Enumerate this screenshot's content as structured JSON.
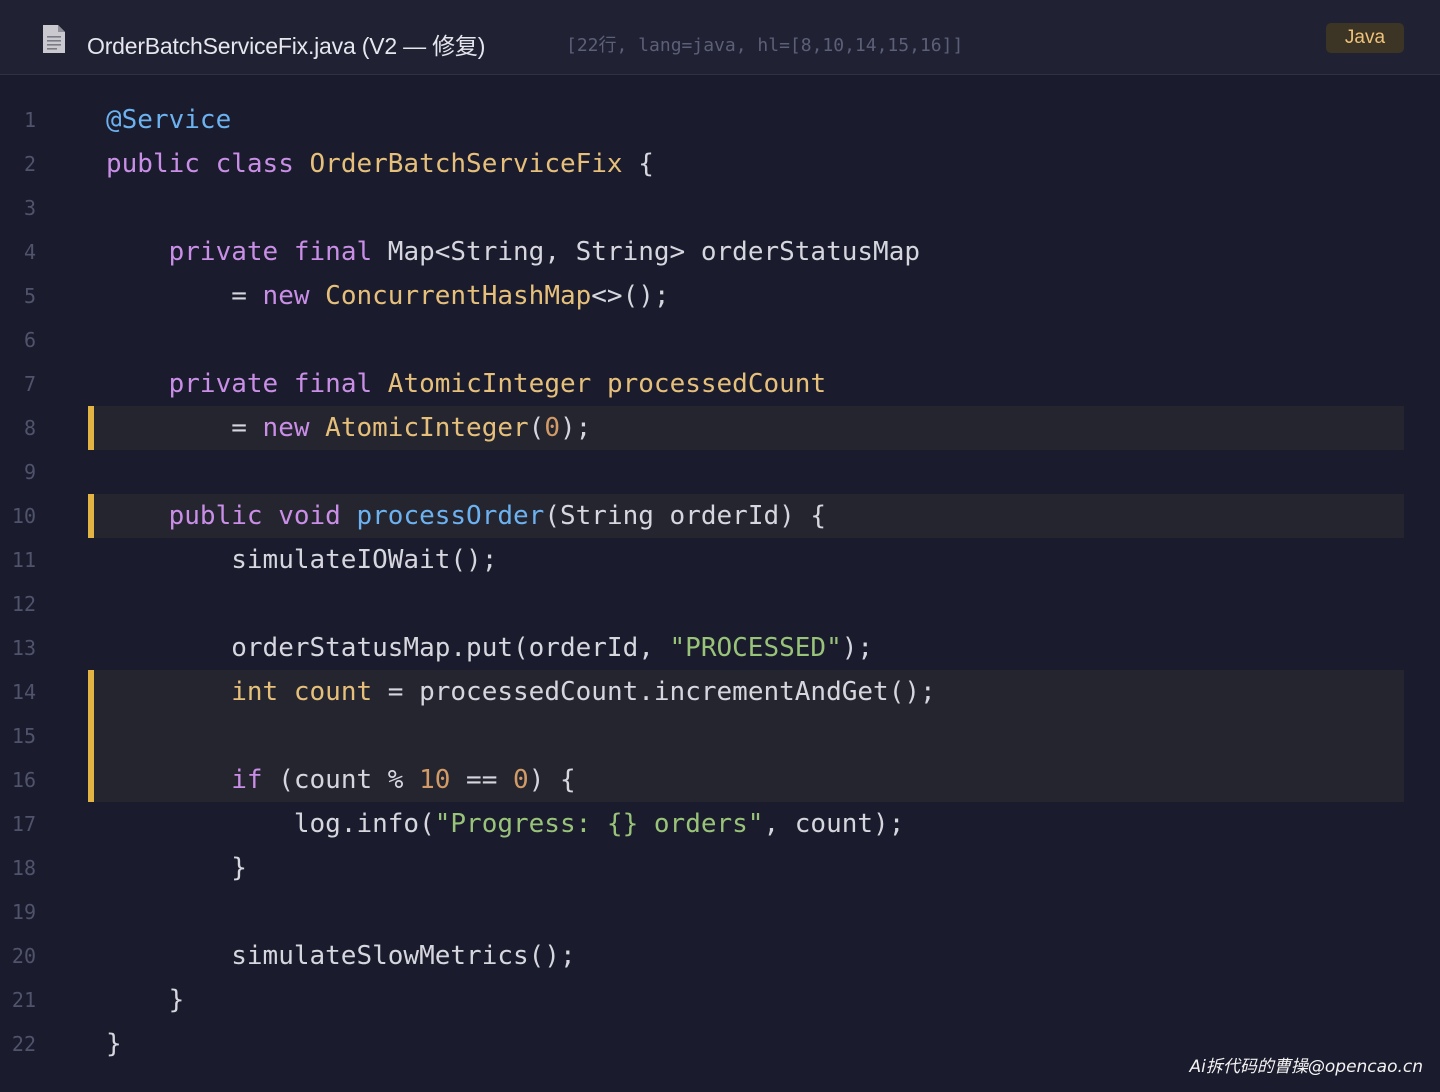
{
  "header": {
    "file_title": "OrderBatchServiceFix.java (V2 — 修复)",
    "meta": "[22行, lang=java, hl=[8,10,14,15,16]]",
    "language_badge": "Java",
    "icon": "file-document-icon"
  },
  "code": {
    "highlighted_lines": [
      8,
      10,
      14,
      15,
      16
    ],
    "lines": [
      {
        "n": "1",
        "indent": "",
        "tokens": [
          [
            "an",
            "@Service"
          ]
        ]
      },
      {
        "n": "2",
        "indent": "",
        "tokens": [
          [
            "kw",
            "public"
          ],
          [
            "",
            " "
          ],
          [
            "kw",
            "class"
          ],
          [
            "",
            " "
          ],
          [
            "ty",
            "OrderBatchServiceFix"
          ],
          [
            "",
            " {"
          ]
        ]
      },
      {
        "n": "3",
        "indent": "",
        "tokens": []
      },
      {
        "n": "4",
        "indent": "    ",
        "tokens": [
          [
            "kw",
            "private"
          ],
          [
            "",
            " "
          ],
          [
            "kw",
            "final"
          ],
          [
            "",
            " Map<String, String> orderStatusMap"
          ]
        ]
      },
      {
        "n": "5",
        "indent": "        ",
        "tokens": [
          [
            "",
            "= "
          ],
          [
            "kw",
            "new"
          ],
          [
            "",
            " "
          ],
          [
            "ty",
            "ConcurrentHashMap"
          ],
          [
            "",
            "<>();"
          ]
        ]
      },
      {
        "n": "6",
        "indent": "",
        "tokens": []
      },
      {
        "n": "7",
        "indent": "    ",
        "tokens": [
          [
            "kw",
            "private"
          ],
          [
            "",
            " "
          ],
          [
            "kw",
            "final"
          ],
          [
            "",
            " "
          ],
          [
            "ty",
            "AtomicInteger"
          ],
          [
            "",
            " "
          ],
          [
            "ty",
            "processedCount"
          ]
        ]
      },
      {
        "n": "8",
        "indent": "        ",
        "tokens": [
          [
            "",
            "= "
          ],
          [
            "kw",
            "new"
          ],
          [
            "",
            " "
          ],
          [
            "ty",
            "AtomicInteger"
          ],
          [
            "",
            "("
          ],
          [
            "num",
            "0"
          ],
          [
            "",
            ");"
          ]
        ]
      },
      {
        "n": "9",
        "indent": "",
        "tokens": []
      },
      {
        "n": "10",
        "indent": "    ",
        "tokens": [
          [
            "kw",
            "public"
          ],
          [
            "",
            " "
          ],
          [
            "kw",
            "void"
          ],
          [
            "",
            " "
          ],
          [
            "fn",
            "processOrder"
          ],
          [
            "",
            "(String orderId) {"
          ]
        ]
      },
      {
        "n": "11",
        "indent": "        ",
        "tokens": [
          [
            "",
            "simulateIOWait();"
          ]
        ]
      },
      {
        "n": "12",
        "indent": "",
        "tokens": []
      },
      {
        "n": "13",
        "indent": "        ",
        "tokens": [
          [
            "",
            "orderStatusMap.put(orderId, "
          ],
          [
            "str",
            "\"PROCESSED\""
          ],
          [
            "",
            ");"
          ]
        ]
      },
      {
        "n": "14",
        "indent": "        ",
        "tokens": [
          [
            "ty",
            "int"
          ],
          [
            "",
            " "
          ],
          [
            "ty",
            "count"
          ],
          [
            "",
            " = processedCount.incrementAndGet();"
          ]
        ]
      },
      {
        "n": "15",
        "indent": "",
        "tokens": []
      },
      {
        "n": "16",
        "indent": "        ",
        "tokens": [
          [
            "kw",
            "if"
          ],
          [
            "",
            " (count % "
          ],
          [
            "num",
            "10"
          ],
          [
            "",
            " == "
          ],
          [
            "num",
            "0"
          ],
          [
            "",
            ") {"
          ]
        ]
      },
      {
        "n": "17",
        "indent": "            ",
        "tokens": [
          [
            "",
            "log.info("
          ],
          [
            "str",
            "\"Progress: {} orders\""
          ],
          [
            "",
            ", count);"
          ]
        ]
      },
      {
        "n": "18",
        "indent": "        ",
        "tokens": [
          [
            "",
            "}"
          ]
        ]
      },
      {
        "n": "19",
        "indent": "",
        "tokens": []
      },
      {
        "n": "20",
        "indent": "        ",
        "tokens": [
          [
            "",
            "simulateSlowMetrics();"
          ]
        ]
      },
      {
        "n": "21",
        "indent": "    ",
        "tokens": [
          [
            "",
            "}"
          ]
        ]
      },
      {
        "n": "22",
        "indent": "",
        "tokens": [
          [
            "",
            "}"
          ]
        ]
      }
    ]
  },
  "colors": {
    "background": "#1a1b2c",
    "header_background": "#202233",
    "highlight_bar": "#e2b443",
    "highlight_background": "#25252f",
    "keyword": "#c98ee6",
    "type": "#e6c07b",
    "annotation": "#6cb1f0",
    "string": "#98c379",
    "number": "#d19a66"
  },
  "watermark": "Ai拆代码的曹操@opencao.cn"
}
